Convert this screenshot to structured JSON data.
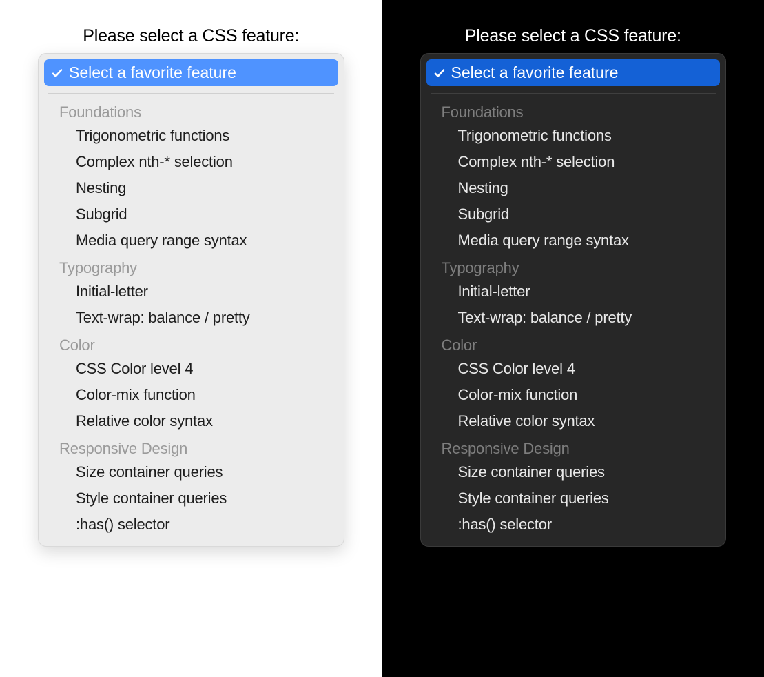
{
  "prompt": "Please select a CSS feature:",
  "selected_label": "Select a favorite feature",
  "colors": {
    "light_highlight": "#4f93ff",
    "dark_highlight": "#1461d6"
  },
  "groups": [
    {
      "label": "Foundations",
      "options": [
        "Trigonometric functions",
        "Complex nth-* selection",
        "Nesting",
        "Subgrid",
        "Media query range syntax"
      ]
    },
    {
      "label": "Typography",
      "options": [
        "Initial-letter",
        "Text-wrap: balance / pretty"
      ]
    },
    {
      "label": "Color",
      "options": [
        "CSS Color level 4",
        "Color-mix function",
        "Relative color syntax"
      ]
    },
    {
      "label": "Responsive Design",
      "options": [
        "Size container queries",
        "Style container queries",
        ":has() selector"
      ]
    }
  ]
}
